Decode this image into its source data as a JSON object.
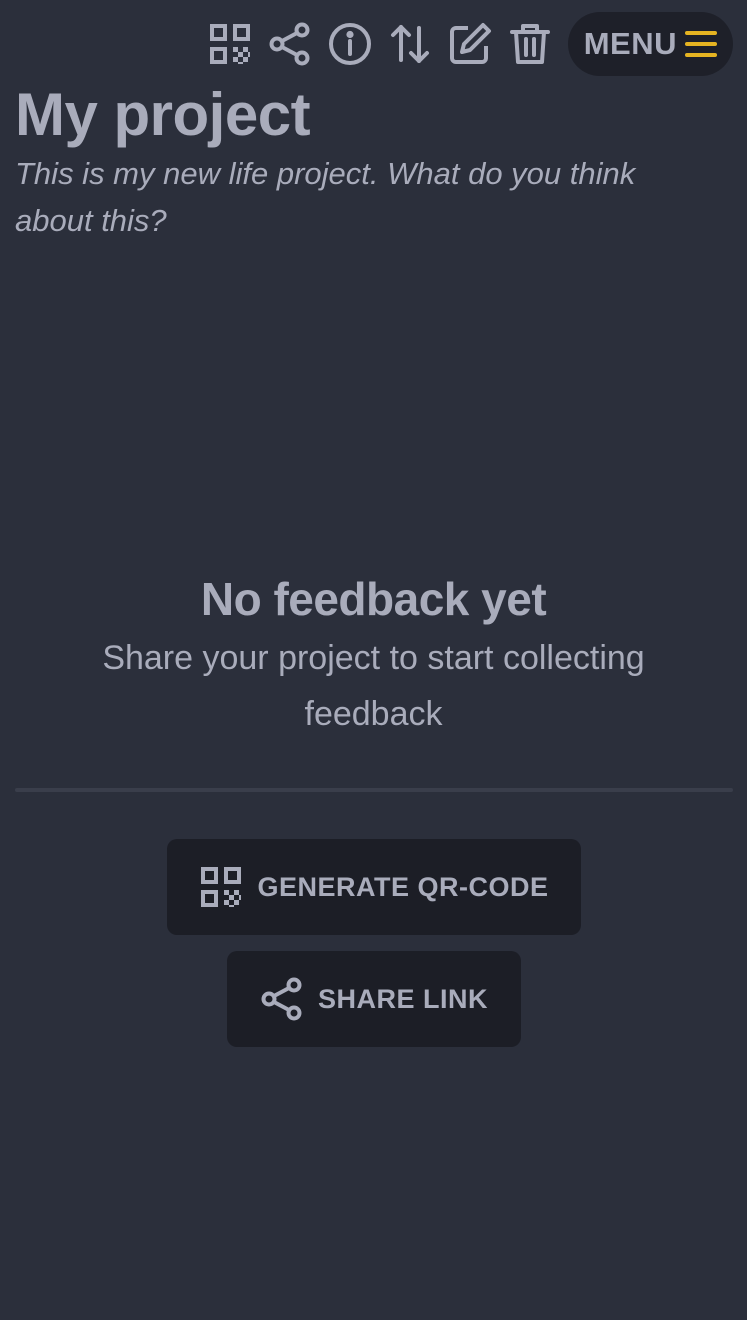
{
  "toolbar": {
    "icons": [
      "qr-code-icon",
      "share-icon",
      "info-icon",
      "sort-icon",
      "edit-icon",
      "trash-icon"
    ],
    "menu_label": "MENU",
    "menu_icon_color": "#e6b422"
  },
  "project": {
    "title": "My project",
    "description": "This is my new life project. What do you think about this?"
  },
  "empty_state": {
    "title": "No feedback yet",
    "subtitle": "Share your project to start collecting feedback"
  },
  "actions": {
    "generate_qr_label": "GENERATE QR-CODE",
    "share_link_label": "SHARE LINK"
  },
  "colors": {
    "background": "#2b2f3b",
    "text": "#a9acbb",
    "button_bg": "#1c1e26",
    "accent": "#e6b422"
  }
}
